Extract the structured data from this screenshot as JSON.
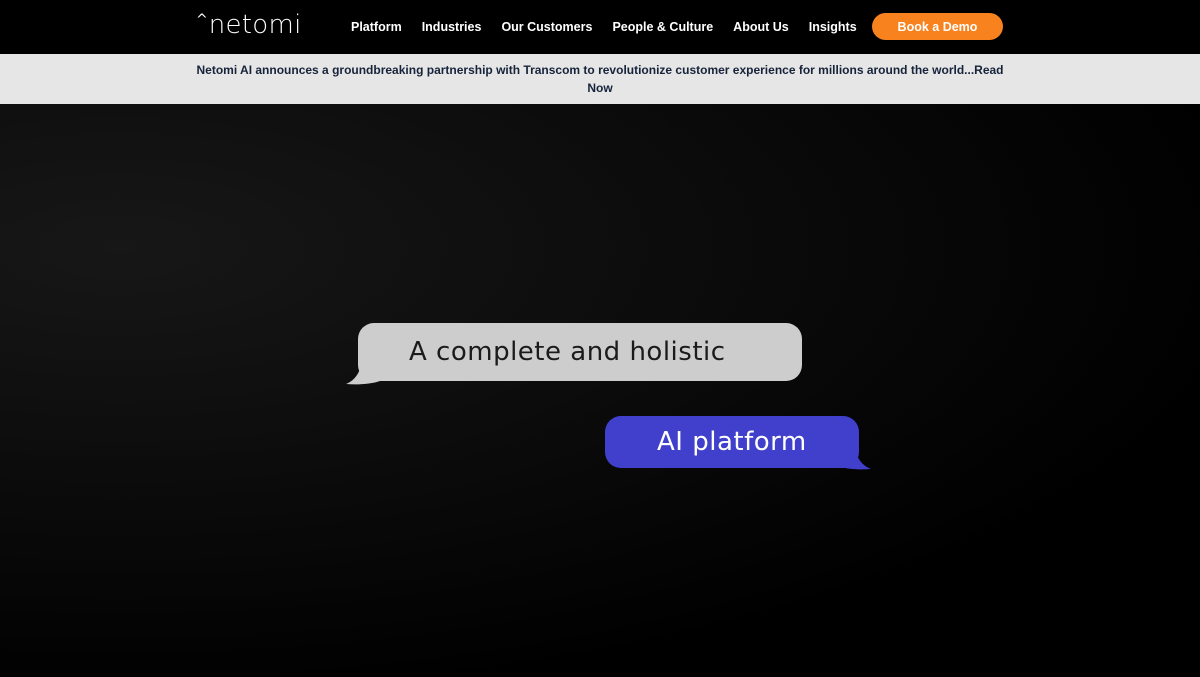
{
  "header": {
    "logo_text": "netomi",
    "logo_caret": "^",
    "nav_items": [
      "Platform",
      "Industries",
      "Our Customers",
      "People & Culture",
      "About Us",
      "Insights"
    ],
    "cta_label": "Book a Demo"
  },
  "announcement": {
    "text": "Netomi AI announces a groundbreaking partnership with Transcom to revolutionize customer experience for millions around the world...Read Now"
  },
  "hero": {
    "bubble_1": "A complete and holistic",
    "bubble_2": "AI platform"
  },
  "colors": {
    "nav_bg": "#000000",
    "cta_bg": "#f7821e",
    "announce_bg": "#e6e6e6",
    "announce_text": "#16233a",
    "bubble_gray": "#cdcdcd",
    "bubble_blue": "#4040cc"
  }
}
